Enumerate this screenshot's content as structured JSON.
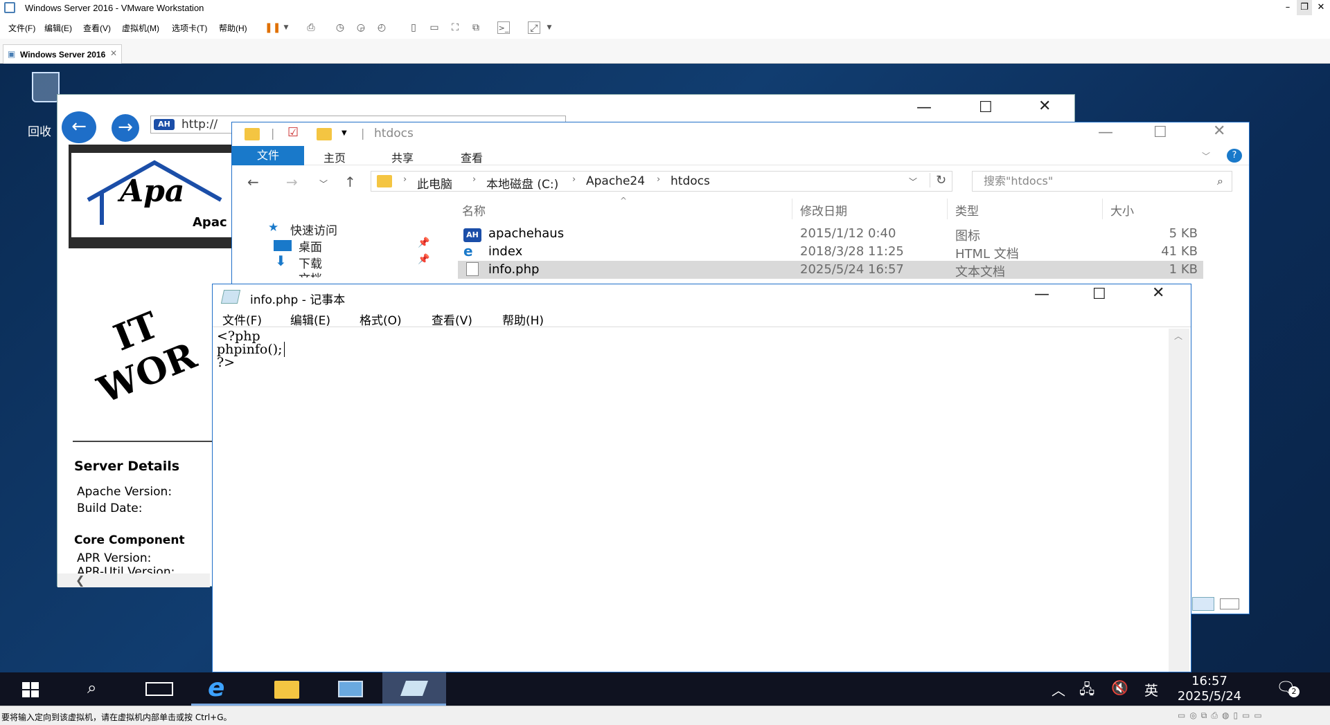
{
  "vmware": {
    "window_title": "Windows Server 2016 - VMware Workstation",
    "menus": [
      "文件(F)",
      "编辑(E)",
      "查看(V)",
      "虚拟机(M)",
      "选项卡(T)",
      "帮助(H)"
    ],
    "tab_label": "Windows Server 2016",
    "status_text": "要将输入定向到该虚拟机，请在虚拟机内部单击或按 Ctrl+G。"
  },
  "desktop": {
    "recycle_bin_label": "回收"
  },
  "browser": {
    "url": "http://",
    "logo_text": "Apa",
    "logo_sub": "Apac",
    "heading_line1": "IT",
    "heading_line2": "WOR",
    "server_details_title": "Server Details",
    "apache_version_label": "Apache Version:",
    "build_date_label": "Build Date:",
    "core_components_title": "Core Component",
    "apr_version_label": "APR Version:",
    "apr_util_label": "APR-Util Version:"
  },
  "explorer": {
    "title": "htdocs",
    "ribbon_tabs": [
      "文件",
      "主页",
      "共享",
      "查看"
    ],
    "breadcrumbs": [
      "此电脑",
      "本地磁盘 (C:)",
      "Apache24",
      "htdocs"
    ],
    "search_placeholder": "搜索\"htdocs\"",
    "columns": [
      "名称",
      "修改日期",
      "类型",
      "大小"
    ],
    "left_pane": [
      "快速访问",
      "桌面",
      "下载",
      "文档"
    ],
    "files": [
      {
        "name": "apachehaus",
        "date": "2015/1/12 0:40",
        "type": "图标",
        "size": "5 KB"
      },
      {
        "name": "index",
        "date": "2018/3/28 11:25",
        "type": "HTML 文档",
        "size": "41 KB"
      },
      {
        "name": "info.php",
        "date": "2025/5/24 16:57",
        "type": "文本文档",
        "size": "1 KB"
      }
    ]
  },
  "notepad": {
    "title": "info.php - 记事本",
    "menus": [
      "文件(F)",
      "编辑(E)",
      "格式(O)",
      "查看(V)",
      "帮助(H)"
    ],
    "content_line1": "<?php",
    "content_line2": "phpinfo();",
    "content_line3": "?>"
  },
  "taskbar": {
    "time": "16:57",
    "date": "2025/5/24",
    "ime": "英",
    "notification_count": "2"
  }
}
